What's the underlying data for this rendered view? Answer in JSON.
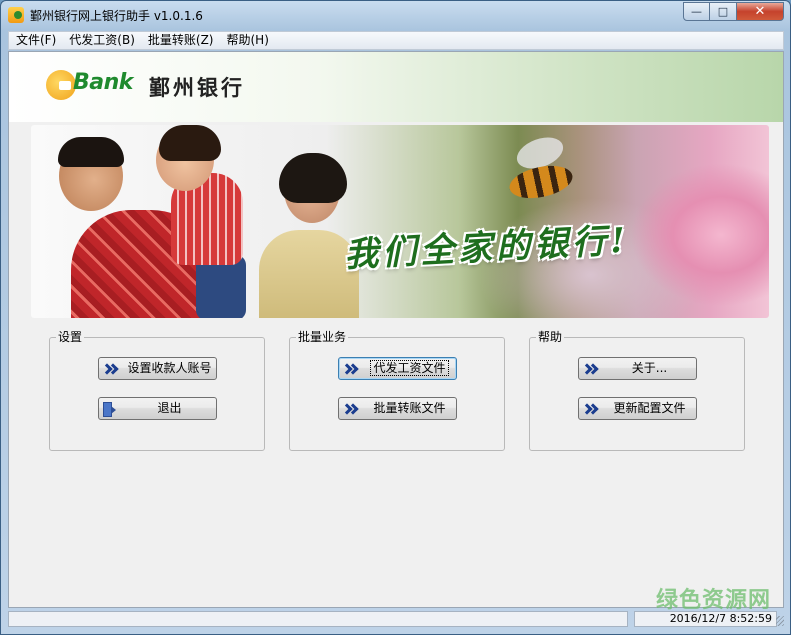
{
  "window": {
    "title": "鄞州银行网上银行助手 v1.0.1.6",
    "minimize_glyph": "—",
    "maximize_glyph": "□",
    "close_glyph": "✕"
  },
  "menu": {
    "items": [
      {
        "label": "文件(F)"
      },
      {
        "label": "代发工资(B)"
      },
      {
        "label": "批量转账(Z)"
      },
      {
        "label": "帮助(H)"
      }
    ]
  },
  "header": {
    "logo_text": "Bank",
    "bank_name": "鄞州银行"
  },
  "banner": {
    "slogan": "我们全家的银行!"
  },
  "groups": {
    "settings": {
      "title": "设置",
      "buttons": [
        {
          "label": "设置收款人账号",
          "icon": "chevron-right-double-icon"
        },
        {
          "label": "退出",
          "icon": "exit-door-icon"
        }
      ]
    },
    "batch": {
      "title": "批量业务",
      "buttons": [
        {
          "label": "代发工资文件",
          "icon": "chevron-right-double-icon"
        },
        {
          "label": "批量转账文件",
          "icon": "chevron-right-double-icon"
        }
      ]
    },
    "help": {
      "title": "帮助",
      "buttons": [
        {
          "label": "关于...",
          "icon": "chevron-right-double-icon"
        },
        {
          "label": "更新配置文件",
          "icon": "chevron-right-double-icon"
        }
      ]
    }
  },
  "status": {
    "message": "",
    "datetime": "2016/12/7  8:52:59"
  },
  "watermark": "绿色资源网",
  "colors": {
    "accent_green": "#1f8a2e",
    "chevron_blue": "#1b3d8f",
    "focus_border": "#3c7fb1"
  }
}
